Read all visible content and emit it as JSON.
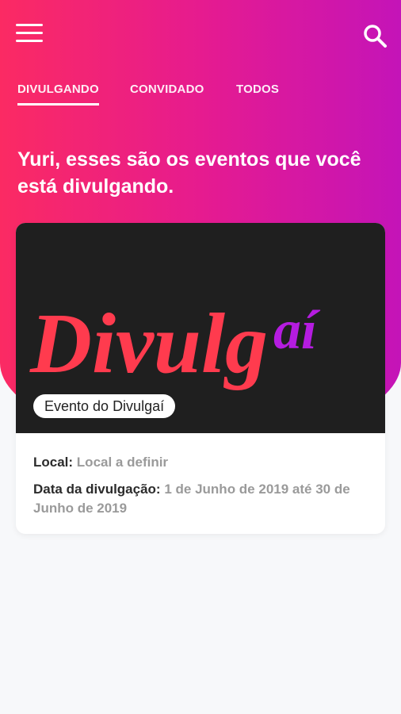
{
  "icons": {
    "menu": "hamburger-menu-icon",
    "search": "search-icon"
  },
  "tabs": [
    {
      "label": "DIVULGANDO",
      "active": true
    },
    {
      "label": "CONVIDADO",
      "active": false
    },
    {
      "label": "TODOS",
      "active": false
    }
  ],
  "headline": "Yuri, esses são os eventos que você está divulgando.",
  "event_card": {
    "logo": {
      "text_main": "Divulg",
      "text_accent": "aí",
      "color_main": "#ff3b4e",
      "color_accent": "#b51ce0"
    },
    "name": "Evento do Divulgaí",
    "location_label": "Local:",
    "location_value": "Local a definir",
    "date_label": "Data da divulgação:",
    "date_value": "1 de Junho de 2019 até 30 de Junho de 2019"
  },
  "colors": {
    "gradient_start": "#fb2a63",
    "gradient_end": "#c414b8",
    "card_image_bg": "#1f1f1f"
  }
}
